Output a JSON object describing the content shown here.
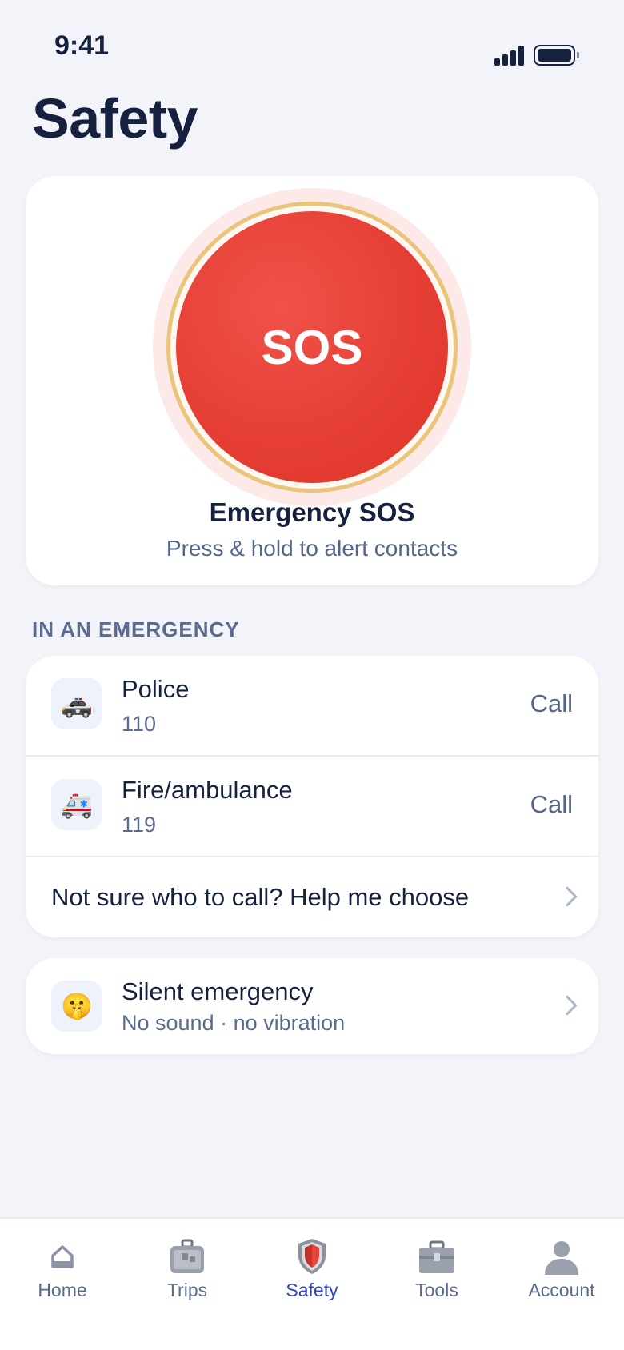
{
  "status_bar": {
    "time": "9:41"
  },
  "page": {
    "title": "Safety"
  },
  "sos": {
    "button_label": "SOS",
    "title": "Emergency SOS",
    "subtitle": "Press & hold to alert contacts",
    "colors": {
      "button": "#e63f35",
      "ring": "#e8c57a",
      "halo": "#fde9e8"
    }
  },
  "emergency": {
    "section_label": "IN AN EMERGENCY",
    "contacts": [
      {
        "icon": "police-car-icon",
        "glyph": "🚓",
        "name": "Police",
        "number": "110",
        "action": "Call"
      },
      {
        "icon": "ambulance-icon",
        "glyph": "🚑",
        "name": "Fire/ambulance",
        "number": "119",
        "action": "Call"
      }
    ],
    "help_link": "Not sure who to call? Help me choose"
  },
  "silent": {
    "icon": "shushing-face-icon",
    "glyph": "🤫",
    "title": "Silent emergency",
    "subtitle": "No sound · no vibration"
  },
  "tabs": [
    {
      "label": "Home",
      "icon": "home-icon",
      "active": false
    },
    {
      "label": "Trips",
      "icon": "luggage-icon",
      "active": false
    },
    {
      "label": "Safety",
      "icon": "shield-icon",
      "active": true
    },
    {
      "label": "Tools",
      "icon": "toolbox-icon",
      "active": false
    },
    {
      "label": "Account",
      "icon": "user-icon",
      "active": false
    }
  ],
  "colors": {
    "background": "#f2f4f9",
    "text": "#15213f",
    "muted": "#5b6b8f",
    "accent": "#2d43c7"
  }
}
